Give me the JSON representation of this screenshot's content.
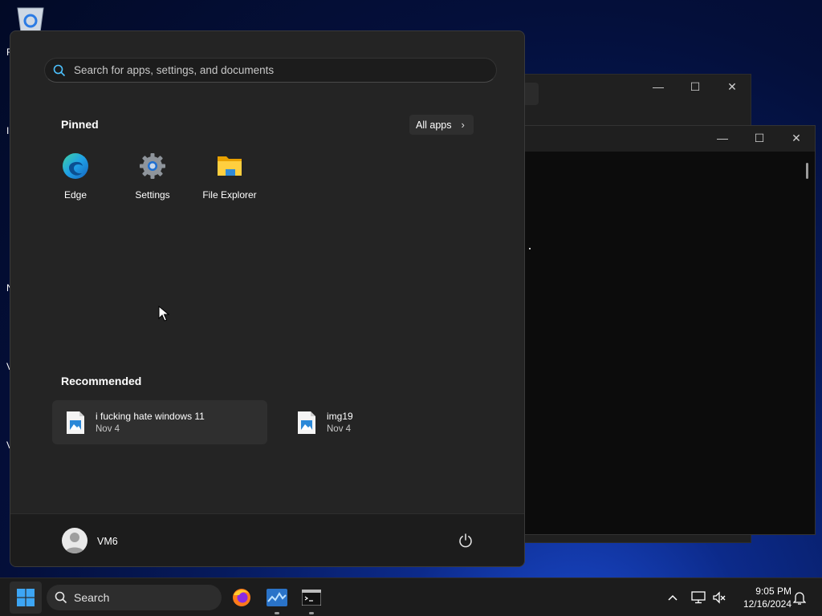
{
  "desktop": {
    "edge_letters": [
      "R",
      "I",
      "N",
      "V",
      "V"
    ]
  },
  "start_menu": {
    "search": {
      "placeholder": "Search for apps, settings, and documents"
    },
    "pinned": {
      "title": "Pinned",
      "all_apps_label": "All apps",
      "apps": [
        {
          "label": "Edge",
          "icon": "edge-icon"
        },
        {
          "label": "Settings",
          "icon": "gear-icon"
        },
        {
          "label": "File Explorer",
          "icon": "folder-icon"
        }
      ]
    },
    "recommended": {
      "title": "Recommended",
      "items": [
        {
          "name": "i fucking hate windows 11",
          "date": "Nov 4",
          "icon": "image-file-icon"
        },
        {
          "name": "img19",
          "date": "Nov 4",
          "icon": "image-file-icon"
        }
      ]
    },
    "user": {
      "name": "VM6"
    },
    "power_icon": "power-icon"
  },
  "taskbar": {
    "search_label": "Search",
    "apps": [
      "firefox-icon",
      "task-manager-icon",
      "terminal-icon"
    ],
    "tray": {
      "icons": [
        "chevron-up-icon",
        "network-icon",
        "volume-muted-icon",
        "notification-bell-icon"
      ]
    },
    "clock": {
      "time": "9:05 PM",
      "date": "12/16/2024"
    }
  },
  "colors": {
    "accent": "#0078d4",
    "menu_bg": "#242424",
    "taskbar_bg": "#1c1c1c"
  }
}
